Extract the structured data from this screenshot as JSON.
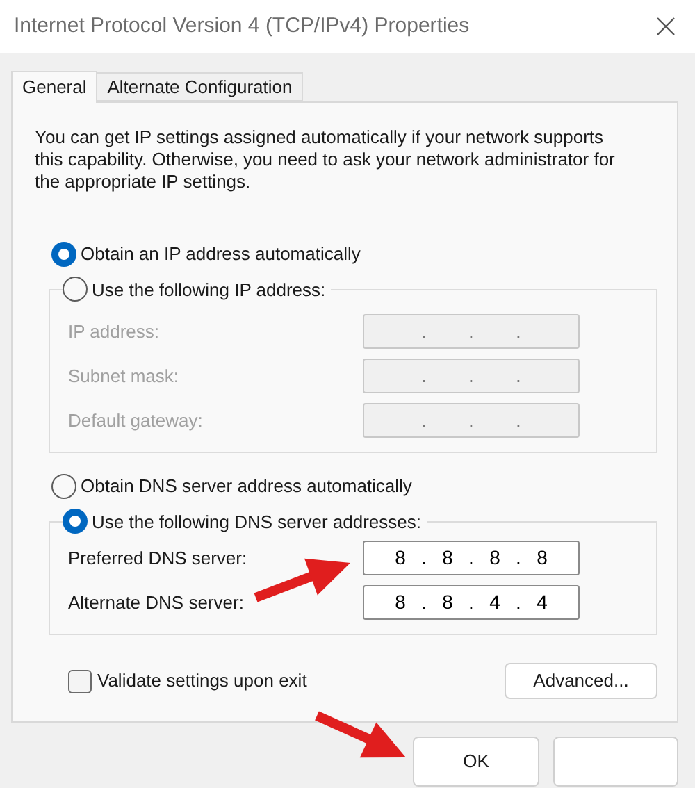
{
  "window": {
    "title": "Internet Protocol Version 4 (TCP/IPv4) Properties"
  },
  "tabs": [
    {
      "label": "General",
      "selected": true
    },
    {
      "label": "Alternate Configuration",
      "selected": false
    }
  ],
  "intro": "You can get IP settings assigned automatically if your network supports this capability. Otherwise, you need to ask your network administrator for the appropriate IP settings.",
  "octet_separator": ".",
  "ip_auto": {
    "label": "Obtain an IP address automatically",
    "selected": true
  },
  "ip_manual": {
    "label": "Use the following IP address:",
    "selected": false,
    "disabled": true,
    "fields": [
      {
        "label": "IP address:"
      },
      {
        "label": "Subnet mask:"
      },
      {
        "label": "Default gateway:"
      }
    ]
  },
  "dns_auto": {
    "label": "Obtain DNS server address automatically",
    "selected": false
  },
  "dns_manual": {
    "label": "Use the following DNS server addresses:",
    "selected": true,
    "disabled": false,
    "fields": [
      {
        "label": "Preferred DNS server:",
        "octets": [
          "8",
          "8",
          "8",
          "8"
        ]
      },
      {
        "label": "Alternate DNS server:",
        "octets": [
          "8",
          "8",
          "4",
          "4"
        ]
      }
    ]
  },
  "validate": {
    "label": "Validate settings upon exit",
    "checked": false
  },
  "advanced_button": "Advanced...",
  "footer_buttons": [
    {
      "kind": "text",
      "label": "OK"
    },
    {
      "kind": "covered"
    }
  ]
}
